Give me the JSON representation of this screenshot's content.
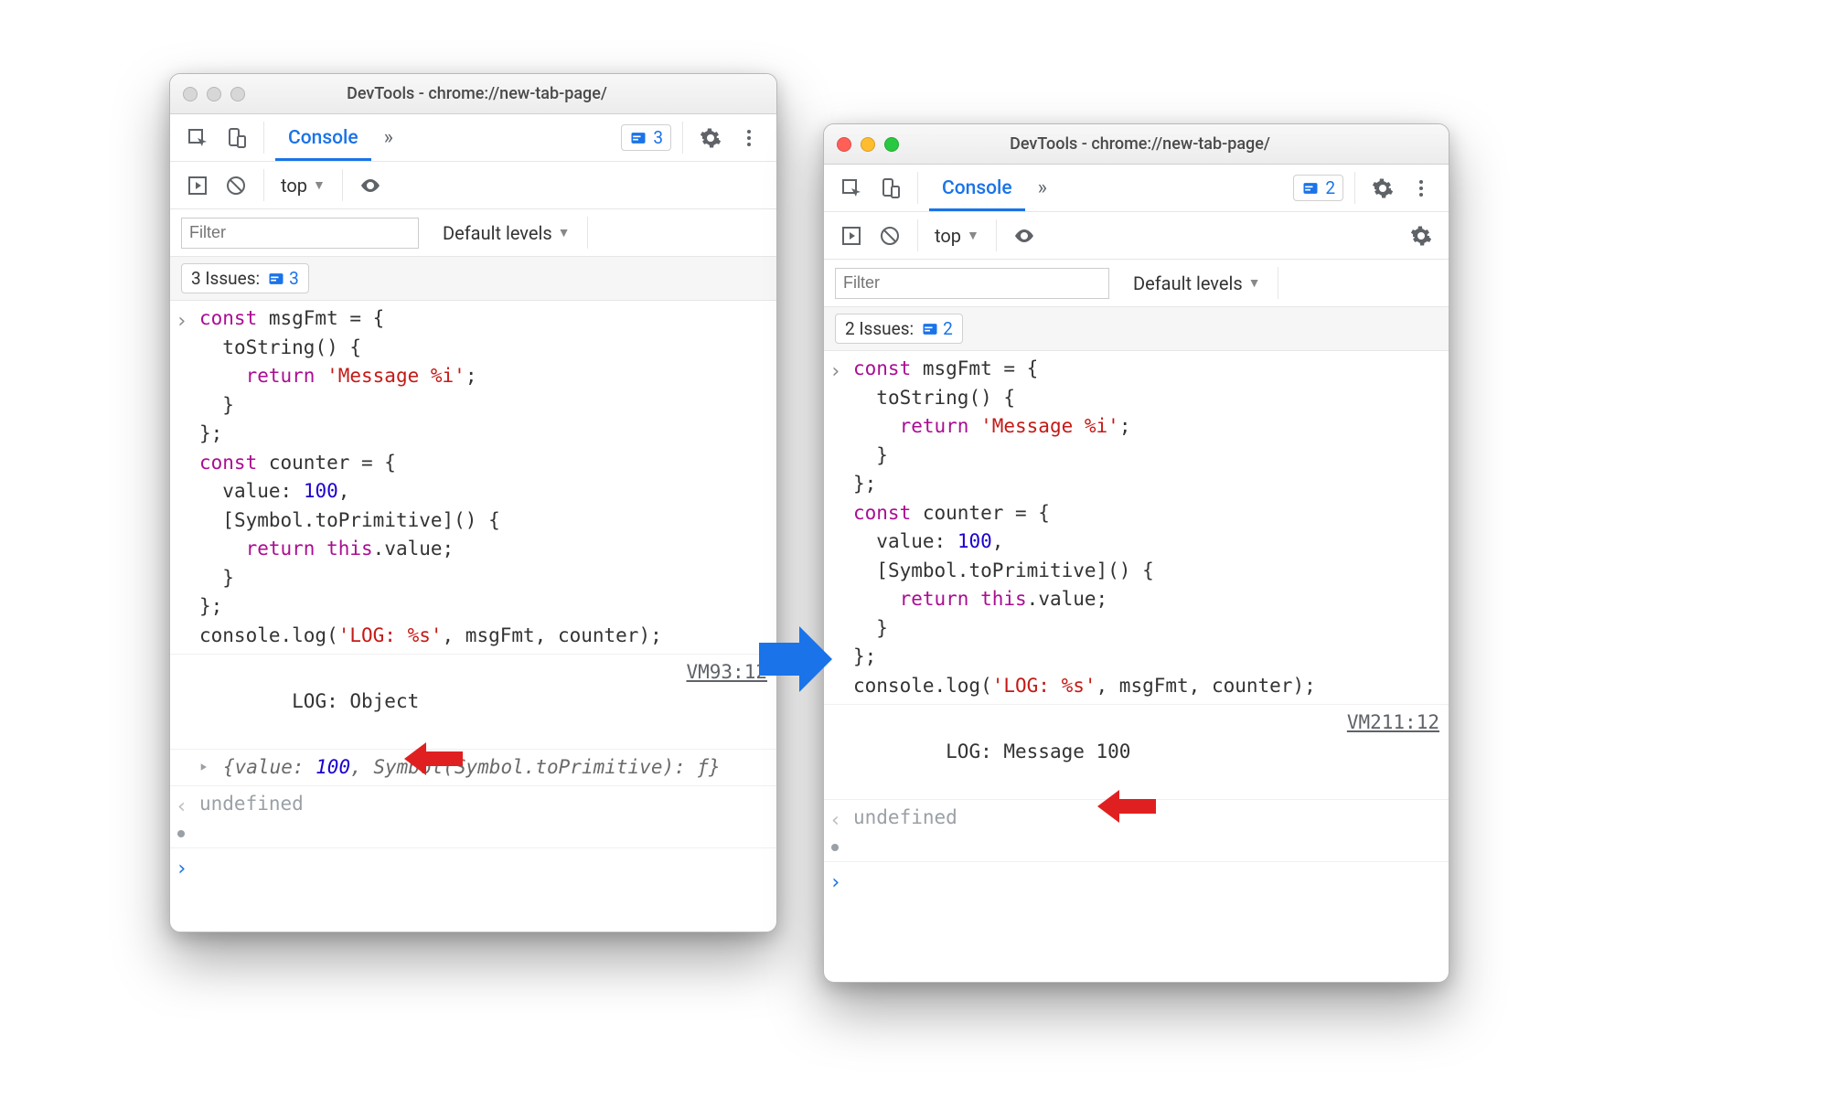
{
  "left": {
    "title": "DevTools - chrome://new-tab-page/",
    "traffic_active": false,
    "tab_label": "Console",
    "more_glyph": "»",
    "issues_count": "3",
    "context_label": "top",
    "filter_placeholder": "Filter",
    "levels_label": "Default levels",
    "issues_label_prefix": "3 Issues:",
    "issues_label_count": "3",
    "code_html": "<span class=\"kw\">const</span> msgFmt = {\n  toString() {\n    <span class=\"kw\">return</span> <span class=\"str\">'Message %i'</span>;\n  }\n};\n<span class=\"kw\">const</span> counter = {\n  value: <span class=\"num\">100</span>,\n  [Symbol.toPrimitive]() {\n    <span class=\"kw\">return</span> <span class=\"this\">this</span>.value;\n  }\n};\nconsole.log(<span class=\"str\">'LOG: %s'</span>, msgFmt, counter);",
    "log_line": "LOG: Object",
    "log_source": "VM93:12",
    "obj_preview_html": "<span class=\"objpreview\">{value: <span class=\"num\">100</span>, Symbol(Symbol.toPrimitive): <span class=\"func\">ƒ</span>}</span>",
    "undefined": "undefined"
  },
  "right": {
    "title": "DevTools - chrome://new-tab-page/",
    "traffic_active": true,
    "tab_label": "Console",
    "more_glyph": "»",
    "issues_count": "2",
    "context_label": "top",
    "filter_placeholder": "Filter",
    "levels_label": "Default levels",
    "issues_label_prefix": "2 Issues:",
    "issues_label_count": "2",
    "code_html": "<span class=\"kw\">const</span> msgFmt = {\n  toString() {\n    <span class=\"kw\">return</span> <span class=\"str\">'Message %i'</span>;\n  }\n};\n<span class=\"kw\">const</span> counter = {\n  value: <span class=\"num\">100</span>,\n  [Symbol.toPrimitive]() {\n    <span class=\"kw\">return</span> <span class=\"this\">this</span>.value;\n  }\n};\nconsole.log(<span class=\"str\">'LOG: %s'</span>, msgFmt, counter);",
    "log_line": "LOG: Message 100",
    "log_source": "VM211:12",
    "undefined": "undefined"
  }
}
